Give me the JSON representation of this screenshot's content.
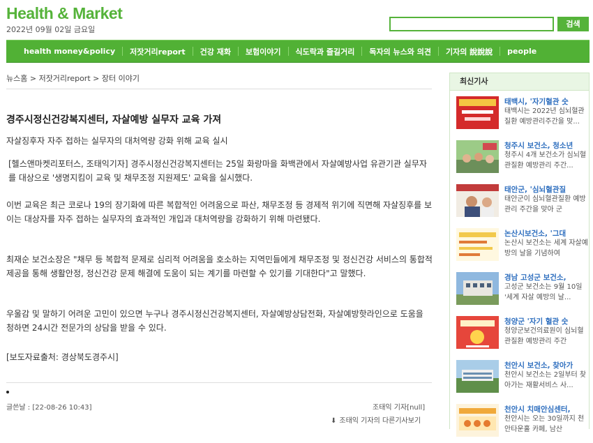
{
  "header": {
    "logo": "Health & Market",
    "date": "2022년 09월 02일 금요일",
    "search_button": "검색"
  },
  "nav": [
    "health money&policy",
    "저잣거리report",
    "건강 재화",
    "보험이야기",
    "식도락과 즐길거리",
    "독자의 뉴스와 의견",
    "기자의 說說說",
    "people"
  ],
  "breadcrumb": "뉴스홈 > 저잣거리report > 장터 이야기",
  "article": {
    "title": "경주시정신건강복지센터, 자살예방 실무자 교육 가져",
    "subtitle": "자살징후자 자주 접하는 실무자의 대처역량 강화 위해 교육 실시",
    "lead": "[헬스앤마켓리포터스, 조태익기자] 경주시정신건강복지센터는 25일 화랑마을 화백관에서 자살예방사업 유관기관 실무자를 대상으로 '생명지킴이 교육 및 채무조정 지원제도' 교육을 실시했다.",
    "p1": "이번 교육은 최근 코로나 19의 장기화에 따른 복합적인 어려움으로 파산, 채무조정 등 경제적 위기에 직면해 자살징후를 보이는 대상자를 자주 접하는 실무자의 효과적인 개입과 대처역량을 강화하기 위해 마련됐다.",
    "p2": "최재순 보건소장은 \"채무 등 복합적 문제로 심리적 어려움을 호소하는 지역민들에게 채무조정 및 정신건강 서비스의 통합적 제공을 통해 생활안정, 정신건강 문제 해결에 도움이 되는 계기를 마련할 수 있기를 기대한다\"고 말했다.",
    "p3": "우울감 및 말하기 어려운 고민이 있으면 누구나 경주시정신건강복지센터, 자살예방상담전화, 자살예방핫라인으로 도움을 청하면 24시간 전문가의 상담을 받을 수 있다.",
    "source": "[보도자료출처: 경상북도경주시]",
    "published": "글쓴날 : [22-08-26 10:43]",
    "author": "조태익 기자[null]",
    "more": "조태익 기자의 다른기사보기"
  },
  "sidebar": {
    "heading": "최신기사",
    "items": [
      {
        "title": "태백시, '자기혈관 숫",
        "desc": "태백시는 2022년 심뇌혈관질환 예방관리주간을 맞..."
      },
      {
        "title": "청주시 보건소, 청소년",
        "desc": "청주시 4개 보건소가 심뇌혈관질환 예방관리 주간..."
      },
      {
        "title": "태안군, '심뇌혈관질",
        "desc": "태안군이 심뇌혈관질환 예방관리 주간을 맞아 군"
      },
      {
        "title": "논산시보건소, '그대",
        "desc": "논산시 보건소는 세계 자살예방의 날을 기념하여"
      },
      {
        "title": "경남 고성군 보건소,",
        "desc": "고성군 보건소는 9월 10일 '세계 자살 예방의 날..."
      },
      {
        "title": "청양군 '자기 혈관 숫",
        "desc": "청양군보건의료원이 심뇌혈관질환 예방관리 주간"
      },
      {
        "title": "천안시 보건소, 찾아가",
        "desc": "천안시 보건소는 2일부터 찾아가는 재활서비스 사..."
      },
      {
        "title": "천안시 치매안심센터,",
        "desc": "천안시는 오는 30일까지 천안타운홀 카페, 남산"
      }
    ]
  }
}
